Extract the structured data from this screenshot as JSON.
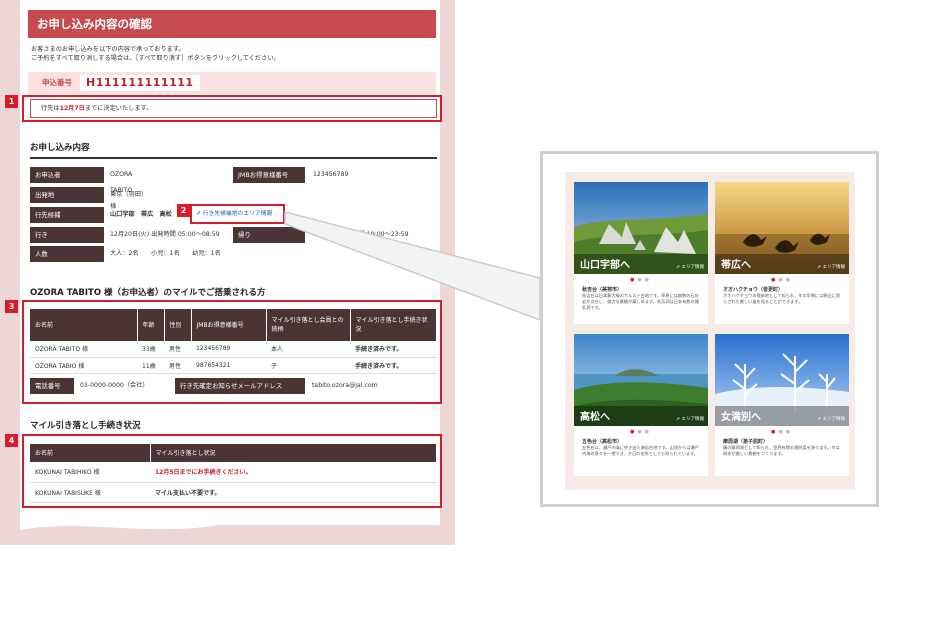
{
  "page": {
    "title": "お申し込み内容の確認",
    "intro_line1": "お客さまのお申し込みを以下の内容で承っております。",
    "intro_line2": "ご予約をすべて取り消しする場合は、［すべて取り消す］ボタンをクリックしてください。"
  },
  "application": {
    "label": "申込番号",
    "number": "H111111111111"
  },
  "callouts": [
    "1",
    "2",
    "3",
    "4"
  ],
  "notice": {
    "prefix": "行先は",
    "date": "12月7日",
    "suffix": "までに決定いたします。"
  },
  "details": {
    "heading": "お申し込み内容",
    "applicant_label": "お申込者",
    "applicant_value": "OZORA TABITO 様",
    "jmb_label": "JMBお得意様番号",
    "jmb_value": "123456789",
    "departure_label": "出発地",
    "departure_value": "東京（羽田）",
    "candidates_label": "行先候補",
    "candidates_value": "山口宇部　帯広　高松　女",
    "area_link": "行き先候補地のエリア情報",
    "outbound_label": "行き",
    "outbound_value": "12月20日(火) 出発時間 05:00〜08:59",
    "return_label": "帰り",
    "return_value": "12月",
    "return_suffix": "(水) 到着時間 19:00〜23:59",
    "people_label": "人数",
    "people_value": "大人：2名　　小児：1名　　幼児：1名"
  },
  "miles": {
    "heading": "OZORA TABITO 様（お申込者）のマイルでご搭乗される方",
    "headers": [
      "お名前",
      "年齢",
      "性別",
      "JMBお得意様番号",
      "マイル引き落とし会員との続柄",
      "マイル引き落とし手続き状況"
    ],
    "rows": [
      [
        "OZORA TABITO 様",
        "33歳",
        "男性",
        "123456789",
        "本人",
        "手続き済みです。"
      ],
      [
        "OZORA TABIO 様",
        "11歳",
        "男性",
        "987654321",
        "子",
        "手続き済みです。"
      ]
    ],
    "phone_label": "電話番号",
    "phone_value": "03-0000-0000（会社）",
    "email_label": "行き先確定お知らせメールアドレス",
    "email_value": "tabito.ozora@jal.com"
  },
  "deduction": {
    "heading": "マイル引き落とし手続き状況",
    "headers": [
      "お名前",
      "マイル引き落とし状況"
    ],
    "rows": [
      [
        "KOKUNAI TABIHIKO 様",
        "12月5日までにお手続きください。"
      ],
      [
        "KOKUNAI TABISUKE 様",
        "マイル支払い不要です。"
      ]
    ]
  },
  "destinations": {
    "tag": "エリア情報",
    "cards": [
      {
        "name": "山口宇部へ",
        "sub": "秋吉台（美祢市）",
        "desc": "秋吉台は日本最大級のカルスト台地です。草原には無数の石灰岩が点在し、雄大な景観が楽しめます。秋芳洞は日本有数の鍾乳洞です。"
      },
      {
        "name": "帯広へ",
        "sub": "オオハクチョウ（音更町）",
        "desc": "オオハクチョウの飛来地として知られ、冬の早朝には朝日に照らされた美しい姿を見ることができます。"
      },
      {
        "name": "高松へ",
        "sub": "五色台（高松市）",
        "desc": "五色台は、瀬戸内海に突き出た溶岩台地です。山頂からは瀬戸内海の島々を一望でき、夕日の名所としても知られています。"
      },
      {
        "name": "女満別へ",
        "sub": "摩周湖（弟子屈町）",
        "desc": "霧の摩周湖として知られ、世界有数の透明度を誇ります。冬は樹氷が美しい景観をつくります。"
      }
    ]
  },
  "colors": {
    "brand": "#c54b51",
    "accent_red": "#d81c2a",
    "header_dark": "#4a3434",
    "paper": "#ecd6d6"
  }
}
